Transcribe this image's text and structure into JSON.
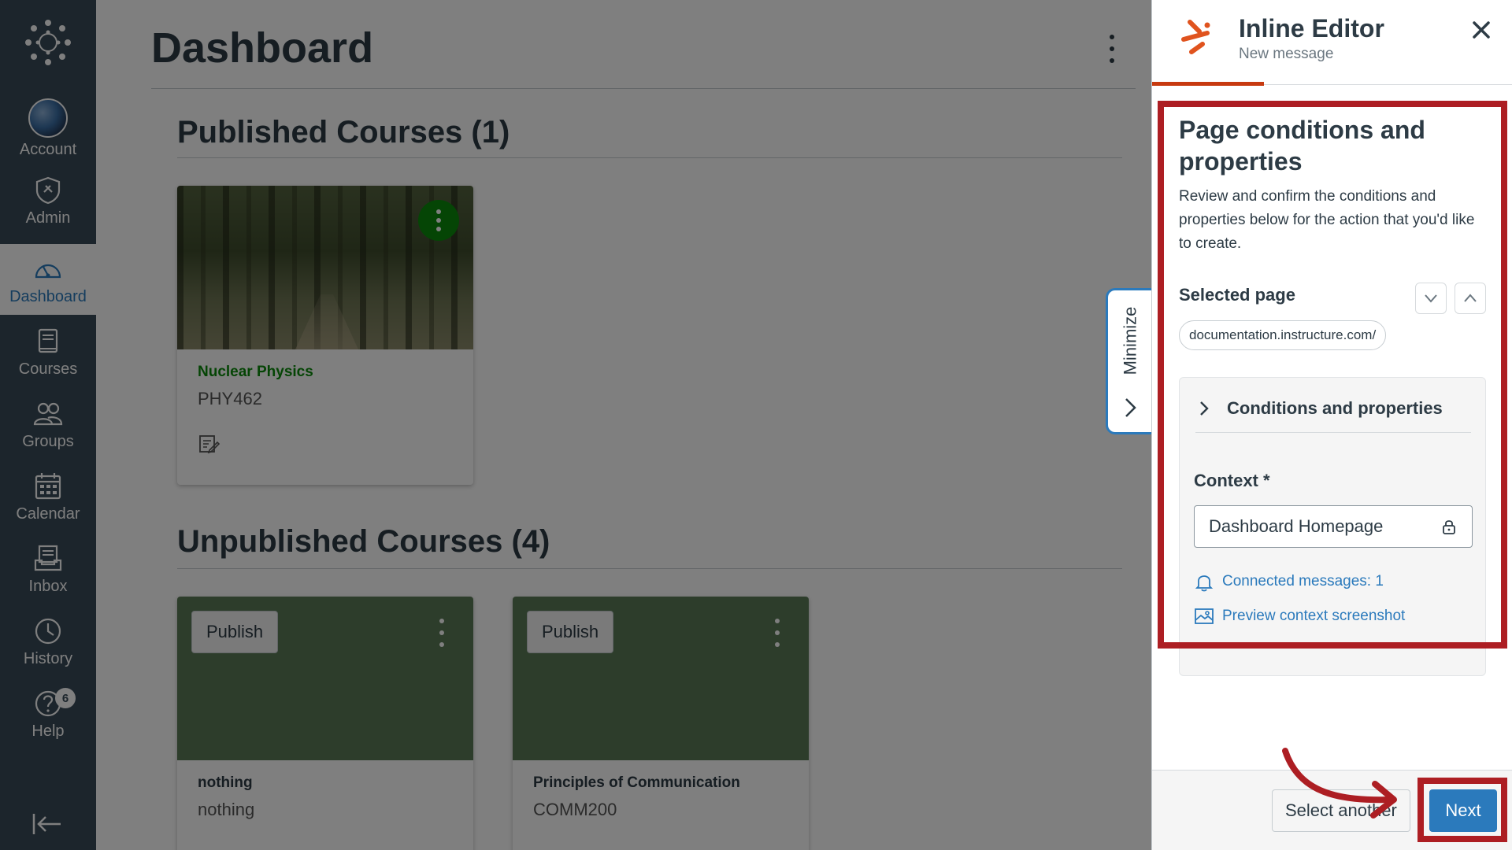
{
  "nav": {
    "items": [
      {
        "label": "Account",
        "icon": "avatar"
      },
      {
        "label": "Admin",
        "icon": "shield-icon"
      },
      {
        "label": "Dashboard",
        "icon": "dashboard-icon"
      },
      {
        "label": "Courses",
        "icon": "book-icon"
      },
      {
        "label": "Groups",
        "icon": "people-icon"
      },
      {
        "label": "Calendar",
        "icon": "calendar-icon"
      },
      {
        "label": "Inbox",
        "icon": "inbox-icon"
      },
      {
        "label": "History",
        "icon": "clock-icon"
      },
      {
        "label": "Help",
        "icon": "help-icon",
        "badge": "6"
      }
    ],
    "active": "Dashboard"
  },
  "main": {
    "title": "Dashboard",
    "published_title": "Published Courses (1)",
    "unpublished_title": "Unpublished Courses (4)",
    "published_courses": [
      {
        "name": "Nuclear Physics",
        "code": "PHY462"
      }
    ],
    "unpublished_courses": [
      {
        "name": "nothing",
        "code": "nothing",
        "publish_label": "Publish"
      },
      {
        "name": "Principles of Communication",
        "code": "COMM200",
        "publish_label": "Publish"
      }
    ]
  },
  "minimize": {
    "label": "Minimize"
  },
  "panel": {
    "title": "Inline Editor",
    "subtitle": "New message",
    "section_title": "Page conditions and properties",
    "description": "Review and confirm the conditions and properties below for the action that you'd like to create.",
    "selected_page_label": "Selected page",
    "selected_page_url": "documentation.instructure.com/",
    "conditions_label": "Conditions and properties",
    "context_label": "Context *",
    "context_value": "Dashboard Homepage",
    "connected_messages": "Connected messages: 1",
    "preview_link": "Preview context screenshot",
    "select_another_label": "Select another",
    "next_label": "Next"
  },
  "colors": {
    "nav_bg": "#394b58",
    "accent_blue": "#2b7abc",
    "course_green": "#0b8a0b",
    "highlight_red": "#ad1e23",
    "panel_accent": "#c73a10"
  }
}
